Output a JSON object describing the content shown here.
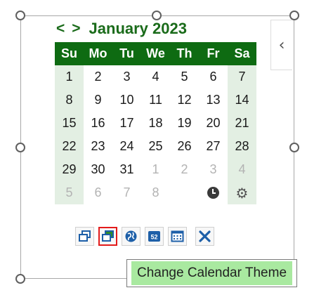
{
  "header": {
    "prev": "<",
    "next": ">",
    "month_year": "January 2023"
  },
  "side_tab": {
    "label": "‹"
  },
  "weekdays": [
    "Su",
    "Mo",
    "Tu",
    "We",
    "Th",
    "Fr",
    "Sa"
  ],
  "weeks": [
    [
      "1",
      "2",
      "3",
      "4",
      "5",
      "6",
      "7"
    ],
    [
      "8",
      "9",
      "10",
      "11",
      "12",
      "13",
      "14"
    ],
    [
      "15",
      "16",
      "17",
      "18",
      "19",
      "20",
      "21"
    ],
    [
      "22",
      "23",
      "24",
      "25",
      "26",
      "27",
      "28"
    ],
    [
      "29",
      "30",
      "31",
      "1",
      "2",
      "3",
      "4"
    ],
    [
      "5",
      "6",
      "7",
      "8"
    ]
  ],
  "footer_icons": {
    "clock": "clock-icon",
    "gear": "⚙"
  },
  "toolbar": {
    "buttons": [
      {
        "icon": "restore-window-icon"
      },
      {
        "icon": "change-theme-icon",
        "selected": true
      },
      {
        "icon": "globe-icon"
      },
      {
        "icon": "week-number-icon",
        "label": "52"
      },
      {
        "icon": "calendar-view-icon"
      },
      {
        "icon": "close-icon"
      }
    ]
  },
  "tooltip": {
    "text": "Change Calendar Theme"
  },
  "colors": {
    "accent": "#0e6b12",
    "weekend": "#e3efe3",
    "tooltip_bg": "#a9e9a0",
    "selected_border": "#e31b1b",
    "close": "#1d5fa8"
  }
}
